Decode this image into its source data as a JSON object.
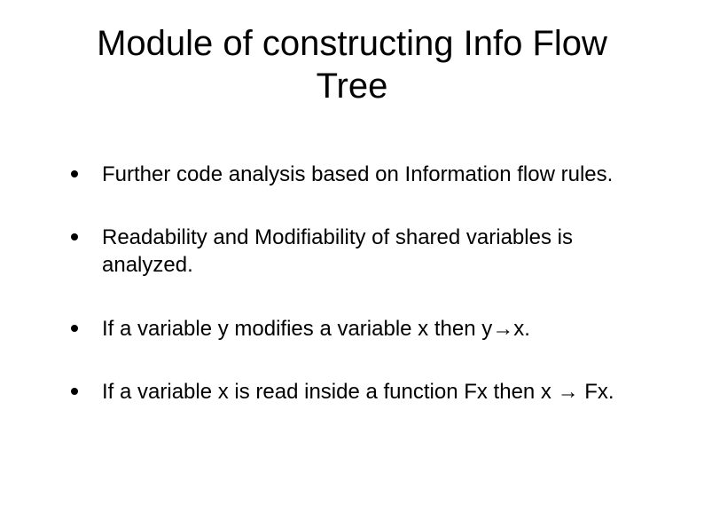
{
  "title": "Module of constructing Info Flow Tree",
  "bullets": [
    "Further code analysis based on Information flow rules.",
    "Readability and Modifiability of shared variables is analyzed.",
    "If a variable y modifies a variable x then y→x.",
    "If a variable x is read inside a function Fx then x → Fx."
  ]
}
